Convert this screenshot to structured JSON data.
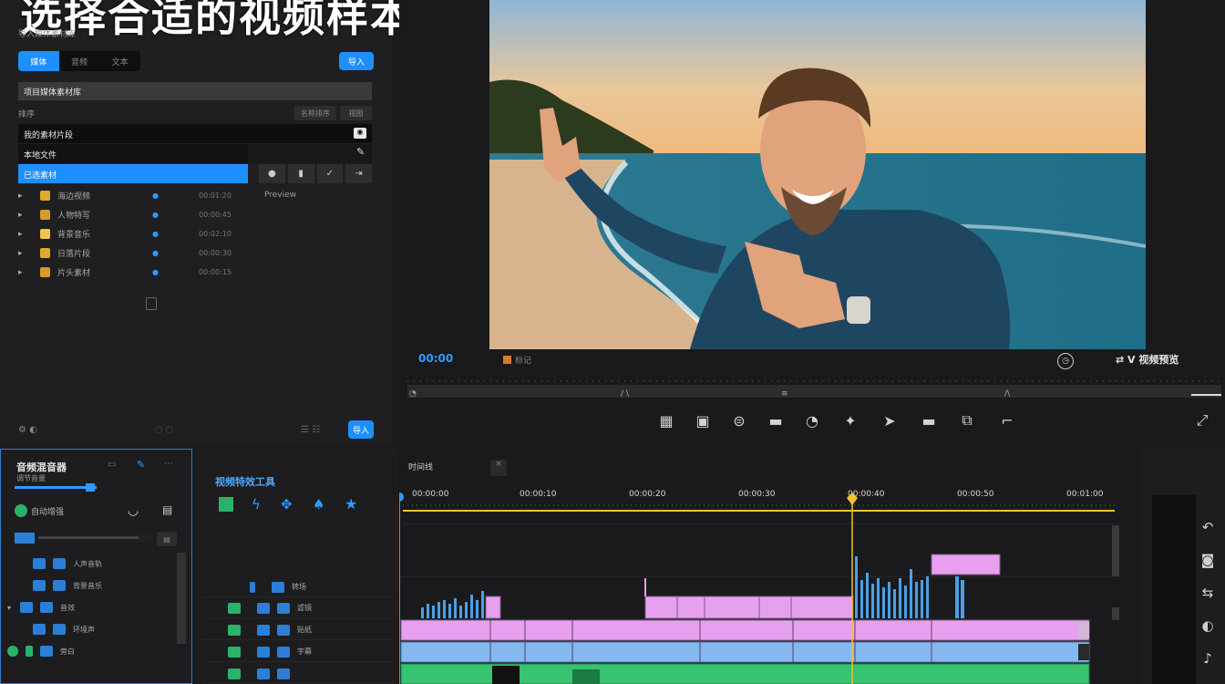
{
  "page_title": "选择合适的视频样本",
  "media_panel": {
    "header_text": "导入媒体素材库",
    "tabs": [
      "媒体",
      "音频",
      "文本"
    ],
    "import_button": "导入",
    "section_title": "项目媒体素材库",
    "filter_text": "排序",
    "sort_label": "名称排序",
    "view_label": "视图",
    "rows": [
      {
        "label": "我的素材片段",
        "icon": "camera-icon"
      },
      {
        "label": "本地文件",
        "icon": "pen-icon"
      },
      {
        "label": "已选素材",
        "icon": "check-icon"
      }
    ],
    "files": [
      {
        "name": "海边视频",
        "meta": "00:01:20"
      },
      {
        "name": "人物特写",
        "meta": "00:00:45"
      },
      {
        "name": "背景音乐",
        "meta": "00:02:10"
      },
      {
        "name": "日落片段",
        "meta": "00:00:30"
      },
      {
        "name": "片头素材",
        "meta": "00:00:15"
      }
    ],
    "preview_label": "Preview",
    "footer_button": "导入"
  },
  "preview": {
    "timecode_left": "00:00",
    "marker_label": "标记",
    "right_label": "V 视频预览",
    "tools": [
      "grid-icon",
      "crop-icon",
      "mask-icon",
      "minus-icon",
      "speed-icon",
      "magic-icon",
      "arrow-icon",
      "caption-icon",
      "split-icon",
      "trim-icon"
    ]
  },
  "audio_panel": {
    "title": "音频混音器",
    "subtitle": "调节音量",
    "toggle_label": "自动增强",
    "rows": [
      "人声音轨",
      "背景音乐",
      "音效",
      "环境声",
      "旁白"
    ]
  },
  "effects_panel": {
    "title": "视频特效工具",
    "rows": [
      "转场",
      "滤镜",
      "贴纸",
      "字幕"
    ]
  },
  "timeline": {
    "tab_label": "时间线",
    "timecodes": [
      "00:00:00",
      "00:00:10",
      "00:00:20",
      "00:00:30",
      "00:00:40",
      "00:00:50",
      "00:01:00"
    ],
    "accent_track": "#e6a0ef",
    "audio_track": "#86b8f0",
    "music_track": "#37c36f"
  },
  "colors": {
    "accent": "#1e8fff",
    "playhead": "#f2c230",
    "panel": "#1f1f21"
  }
}
